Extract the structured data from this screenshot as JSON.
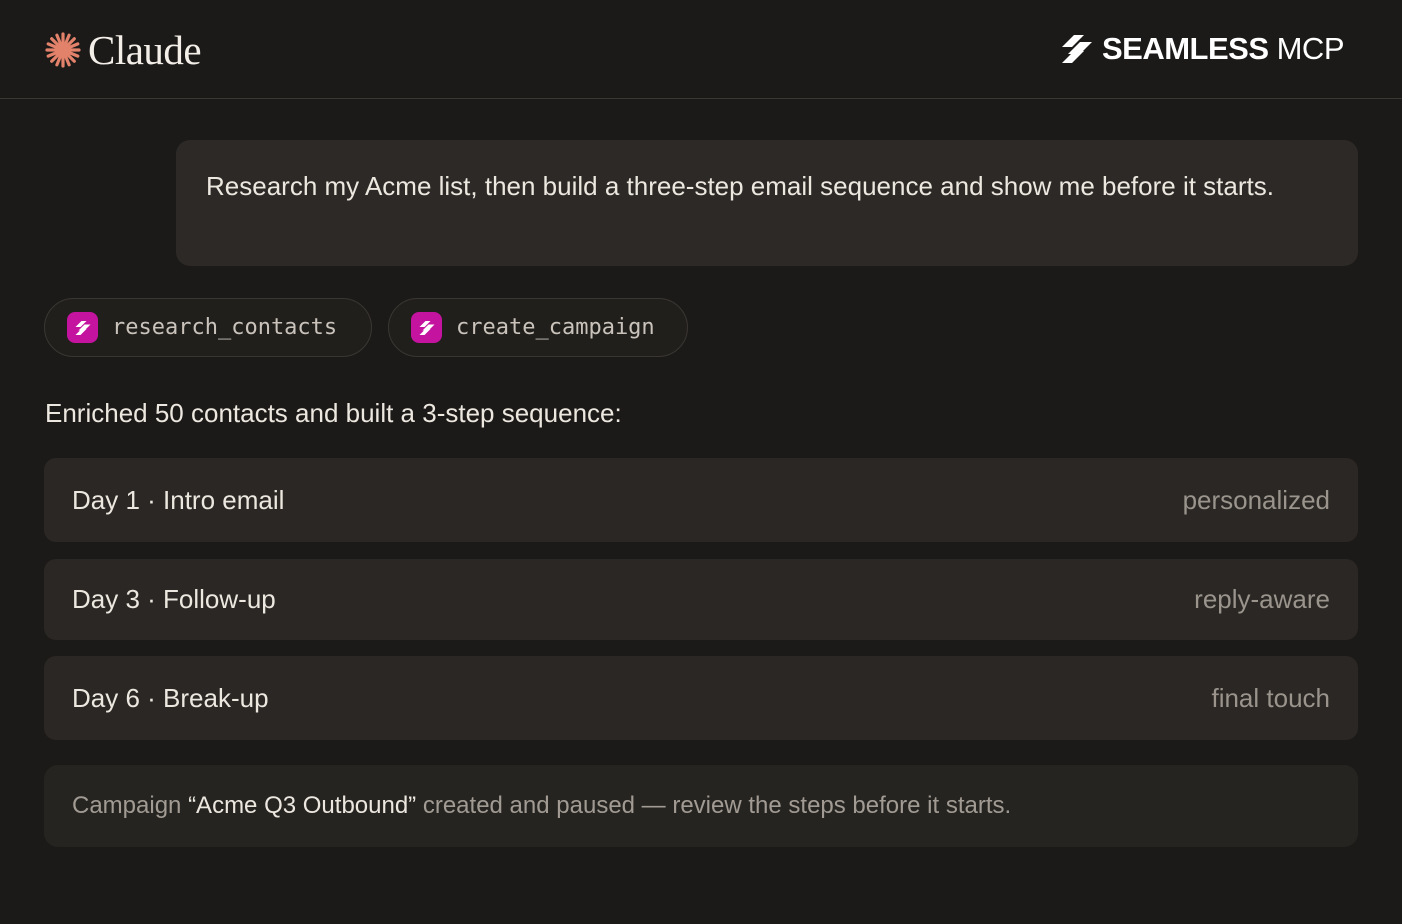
{
  "header": {
    "brand_name": "Claude",
    "brand_color": "#e2826a",
    "partner_name_bold": "SEAMLESS",
    "partner_name_light": " MCP"
  },
  "conversation": {
    "user_message": "Research my Acme list, then build a three-step email sequence and show me before it starts."
  },
  "tools": [
    {
      "label": "research_contacts",
      "icon": "seamless-logo-icon"
    },
    {
      "label": "create_campaign",
      "icon": "seamless-logo-icon"
    }
  ],
  "tool_icon_color": "#c4139e",
  "response": {
    "summary": "Enriched 50 contacts and built a 3-step sequence:",
    "steps": [
      {
        "title": "Day 1 · Intro email",
        "tag": "personalized"
      },
      {
        "title": "Day 3 · Follow-up",
        "tag": "reply-aware"
      },
      {
        "title": "Day 6 · Break-up",
        "tag": "final touch"
      }
    ],
    "notice": {
      "prefix": "Campaign ",
      "campaign_name": "“Acme Q3 Outbound”",
      "suffix": " created and paused — review the steps before it starts."
    }
  }
}
